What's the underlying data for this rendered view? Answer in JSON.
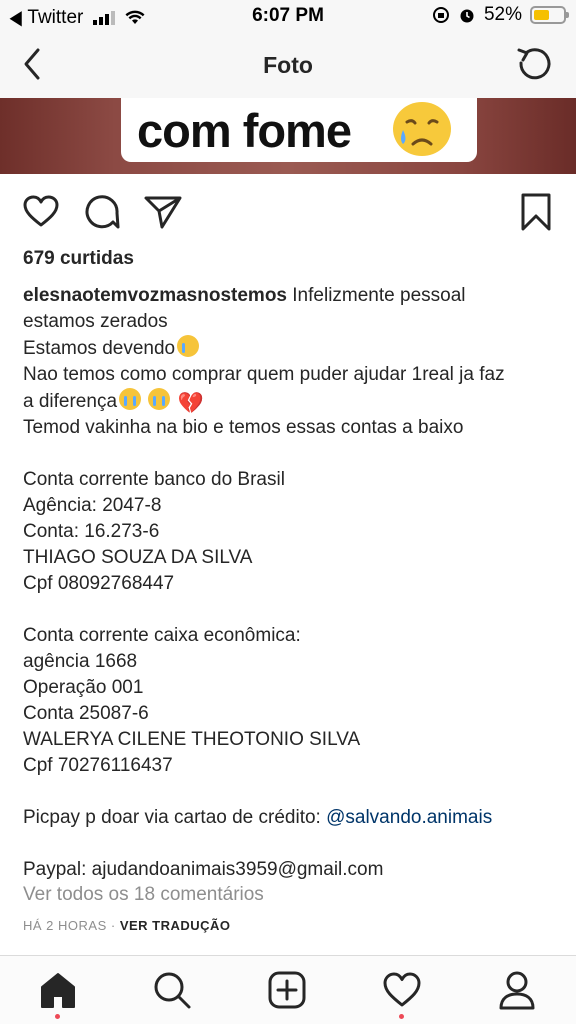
{
  "status_bar": {
    "back_app": "Twitter",
    "time": "6:07 PM",
    "battery": "52%",
    "battery_level": 0.52
  },
  "nav": {
    "title": "Foto"
  },
  "photo": {
    "caption_text": "com fome"
  },
  "post": {
    "likes": "679 curtidas",
    "username": "elesnaotemvozmasnostemos",
    "caption_lines": [
      {
        "text": " Infelizmente pessoal"
      },
      {
        "text": "estamos zerados"
      },
      {
        "text": "Estamos devendo",
        "emoji": "crying-face"
      },
      {
        "text": "Nao temos como comprar quem puder ajudar 1real ja faz"
      },
      {
        "text": "a diferença",
        "emoji": "sob-sob-broken-heart"
      },
      {
        "text": "Temod vakinha na bio e temos essas contas a baixo"
      },
      {
        "text": ""
      },
      {
        "text": "Conta corrente banco do Brasil"
      },
      {
        "text": "Agência: 2047-8"
      },
      {
        "text": "Conta: 16.273-6"
      },
      {
        "text": "THIAGO SOUZA DA SILVA"
      },
      {
        "text": "Cpf 08092768447"
      },
      {
        "text": ""
      },
      {
        "text": "Conta corrente caixa econômica:"
      },
      {
        "text": "agência 1668"
      },
      {
        "text": "Operação 001"
      },
      {
        "text": "Conta 25087-6"
      },
      {
        "text": "WALERYA CILENE THEOTONIO SILVA"
      },
      {
        "text": "Cpf 70276116437"
      },
      {
        "text": ""
      },
      {
        "text": "Picpay p doar via cartao de crédito: ",
        "mention": "@salvando.animais"
      },
      {
        "text": ""
      },
      {
        "text": "Paypal: ajudandoanimais3959@gmail.com"
      }
    ],
    "view_comments": "Ver todos os 18 comentários",
    "time_ago": "HÁ 2 HORAS",
    "separator": " · ",
    "translate": "VER TRADUÇÃO"
  },
  "icons": {
    "like": "heart-icon",
    "comment": "comment-icon",
    "share": "paper-plane-icon",
    "save": "bookmark-icon",
    "tabs": [
      "home-icon",
      "search-icon",
      "add-post-icon",
      "activity-heart-icon",
      "profile-icon"
    ]
  },
  "colors": {
    "mention": "#003569",
    "secondary_text": "#8e8e8e",
    "notification_dot": "#ed4956",
    "battery": "#f5c000"
  }
}
